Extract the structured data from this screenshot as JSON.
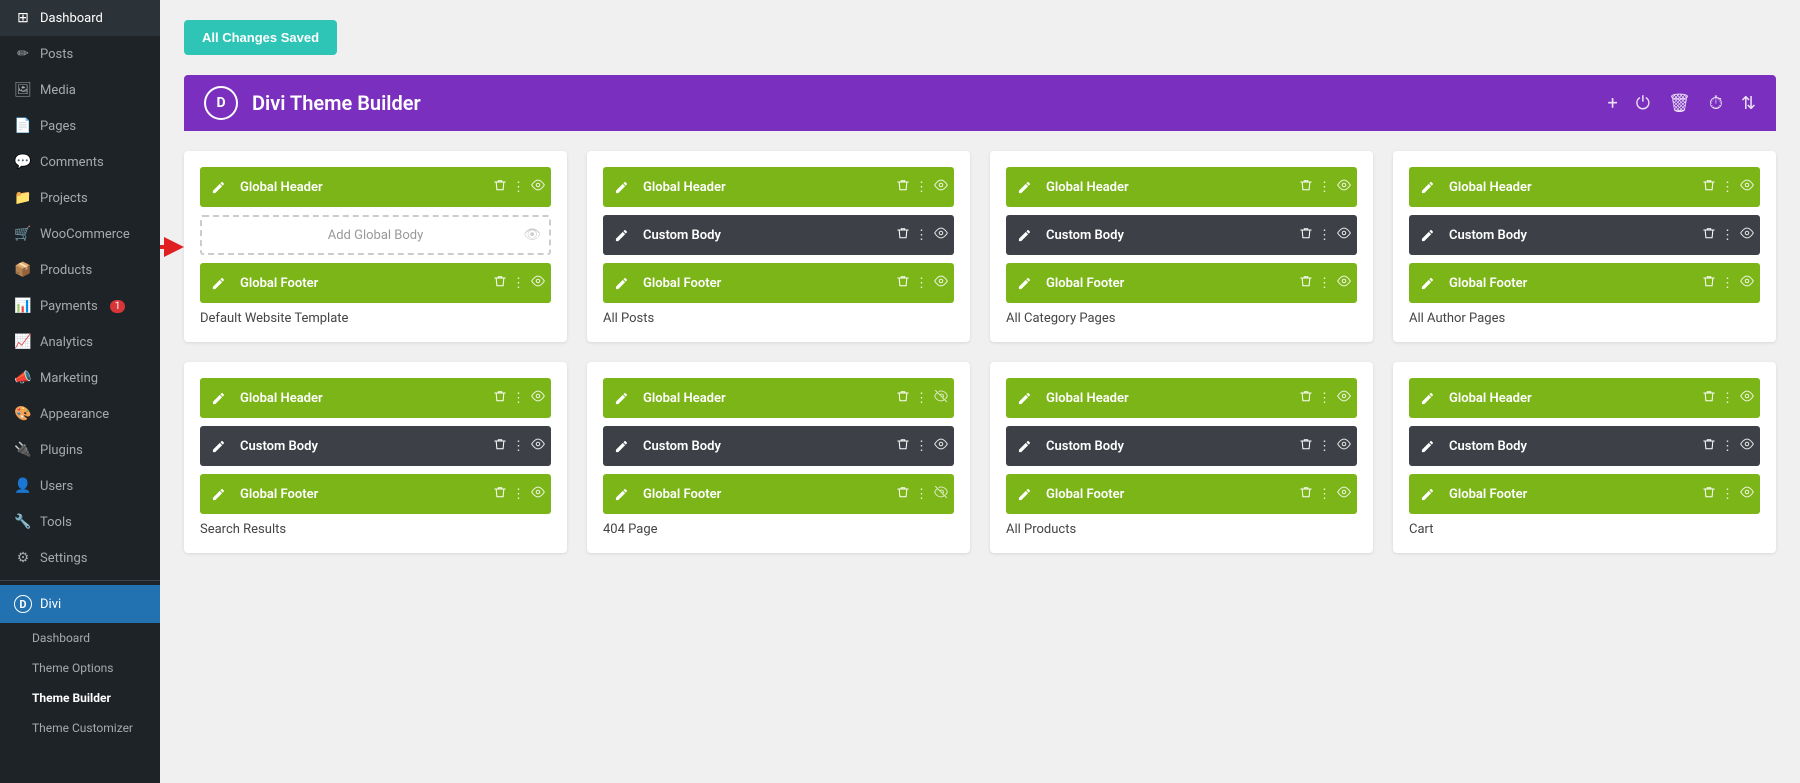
{
  "sidebar": {
    "items": [
      {
        "id": "dashboard",
        "label": "Dashboard",
        "icon": "⊞"
      },
      {
        "id": "posts",
        "label": "Posts",
        "icon": "✏"
      },
      {
        "id": "media",
        "label": "Media",
        "icon": "🖼"
      },
      {
        "id": "pages",
        "label": "Pages",
        "icon": "📄"
      },
      {
        "id": "comments",
        "label": "Comments",
        "icon": "💬"
      },
      {
        "id": "projects",
        "label": "Projects",
        "icon": "📁"
      },
      {
        "id": "woocommerce",
        "label": "WooCommerce",
        "icon": "🛒"
      },
      {
        "id": "products",
        "label": "Products",
        "icon": "📦"
      },
      {
        "id": "payments",
        "label": "Payments",
        "icon": "📊",
        "badge": "1"
      },
      {
        "id": "analytics",
        "label": "Analytics",
        "icon": "📈"
      },
      {
        "id": "marketing",
        "label": "Marketing",
        "icon": "📣"
      },
      {
        "id": "appearance",
        "label": "Appearance",
        "icon": "🎨"
      },
      {
        "id": "plugins",
        "label": "Plugins",
        "icon": "🔌"
      },
      {
        "id": "users",
        "label": "Users",
        "icon": "👤"
      },
      {
        "id": "tools",
        "label": "Tools",
        "icon": "🔧"
      },
      {
        "id": "settings",
        "label": "Settings",
        "icon": "⚙"
      }
    ],
    "divi": {
      "label": "Divi",
      "icon": "D",
      "sub_items": [
        {
          "id": "divi-dashboard",
          "label": "Dashboard"
        },
        {
          "id": "theme-options",
          "label": "Theme Options"
        },
        {
          "id": "theme-builder",
          "label": "Theme Builder",
          "active": true
        },
        {
          "id": "theme-customizer",
          "label": "Theme Customizer"
        }
      ]
    }
  },
  "header": {
    "save_button": "All Changes Saved",
    "theme_builder_title": "Divi Theme Builder",
    "divi_logo": "D",
    "bar_actions": [
      "+",
      "⏻",
      "🗑",
      "⏱",
      "⇅"
    ]
  },
  "cards": [
    {
      "id": "default-website",
      "title": "Default Website Template",
      "rows": [
        {
          "type": "green",
          "label": "Global Header",
          "has_edit": true,
          "has_trash": true,
          "has_dots": true,
          "has_eye": true
        },
        {
          "type": "dashed",
          "label": "Add Global Body",
          "has_eye": true
        },
        {
          "type": "green",
          "label": "Global Footer",
          "has_edit": true,
          "has_trash": true,
          "has_dots": true,
          "has_eye": true
        }
      ],
      "has_arrow": true
    },
    {
      "id": "all-posts",
      "title": "All Posts",
      "rows": [
        {
          "type": "green",
          "label": "Global Header",
          "has_edit": true,
          "has_trash": true,
          "has_dots": true,
          "has_eye": true
        },
        {
          "type": "dark",
          "label": "Custom Body",
          "has_edit": true,
          "has_trash": true,
          "has_dots": true,
          "has_eye": true
        },
        {
          "type": "green",
          "label": "Global Footer",
          "has_edit": true,
          "has_trash": true,
          "has_dots": true,
          "has_eye": true
        }
      ]
    },
    {
      "id": "all-category",
      "title": "All Category Pages",
      "rows": [
        {
          "type": "green",
          "label": "Global Header",
          "has_edit": true,
          "has_trash": true,
          "has_dots": true,
          "has_eye": true
        },
        {
          "type": "dark",
          "label": "Custom Body",
          "has_edit": true,
          "has_trash": true,
          "has_dots": true,
          "has_eye": true
        },
        {
          "type": "green",
          "label": "Global Footer",
          "has_edit": true,
          "has_trash": true,
          "has_dots": true,
          "has_eye": true
        }
      ]
    },
    {
      "id": "all-author",
      "title": "All Author Pages",
      "rows": [
        {
          "type": "green",
          "label": "Global Header",
          "has_edit": true,
          "has_trash": true,
          "has_dots": true,
          "has_eye": true
        },
        {
          "type": "dark",
          "label": "Custom Body",
          "has_edit": true,
          "has_trash": true,
          "has_dots": true,
          "has_eye": true
        },
        {
          "type": "green",
          "label": "Global Footer",
          "has_edit": true,
          "has_trash": true,
          "has_dots": true,
          "has_eye": true
        }
      ]
    },
    {
      "id": "search-results",
      "title": "Search Results",
      "rows": [
        {
          "type": "green",
          "label": "Global Header",
          "has_edit": true,
          "has_trash": true,
          "has_dots": true,
          "has_eye": true
        },
        {
          "type": "dark",
          "label": "Custom Body",
          "has_edit": true,
          "has_trash": true,
          "has_dots": true,
          "has_eye": true
        },
        {
          "type": "green",
          "label": "Global Footer",
          "has_edit": true,
          "has_trash": true,
          "has_dots": true,
          "has_eye": true
        }
      ]
    },
    {
      "id": "404-page",
      "title": "404 Page",
      "rows": [
        {
          "type": "green",
          "label": "Global Header",
          "has_edit": true,
          "has_trash": true,
          "has_dots": true,
          "has_eye": false,
          "eye_slash": true
        },
        {
          "type": "dark",
          "label": "Custom Body",
          "has_edit": true,
          "has_trash": true,
          "has_dots": true,
          "has_eye": true
        },
        {
          "type": "green",
          "label": "Global Footer",
          "has_edit": true,
          "has_trash": true,
          "has_dots": true,
          "has_eye": false,
          "eye_slash": true
        }
      ]
    },
    {
      "id": "all-products",
      "title": "All Products",
      "rows": [
        {
          "type": "green",
          "label": "Global Header",
          "has_edit": true,
          "has_trash": true,
          "has_dots": true,
          "has_eye": true
        },
        {
          "type": "dark",
          "label": "Custom Body",
          "has_edit": true,
          "has_trash": true,
          "has_dots": true,
          "has_eye": true
        },
        {
          "type": "green",
          "label": "Global Footer",
          "has_edit": true,
          "has_trash": true,
          "has_dots": true,
          "has_eye": true
        }
      ]
    },
    {
      "id": "cart",
      "title": "Cart",
      "rows": [
        {
          "type": "green",
          "label": "Global Header",
          "has_edit": true,
          "has_trash": true,
          "has_dots": true,
          "has_eye": true
        },
        {
          "type": "dark",
          "label": "Custom Body",
          "has_edit": true,
          "has_trash": true,
          "has_dots": true,
          "has_eye": true
        },
        {
          "type": "green",
          "label": "Global Footer",
          "has_edit": true,
          "has_trash": true,
          "has_dots": true,
          "has_eye": true
        }
      ]
    }
  ]
}
